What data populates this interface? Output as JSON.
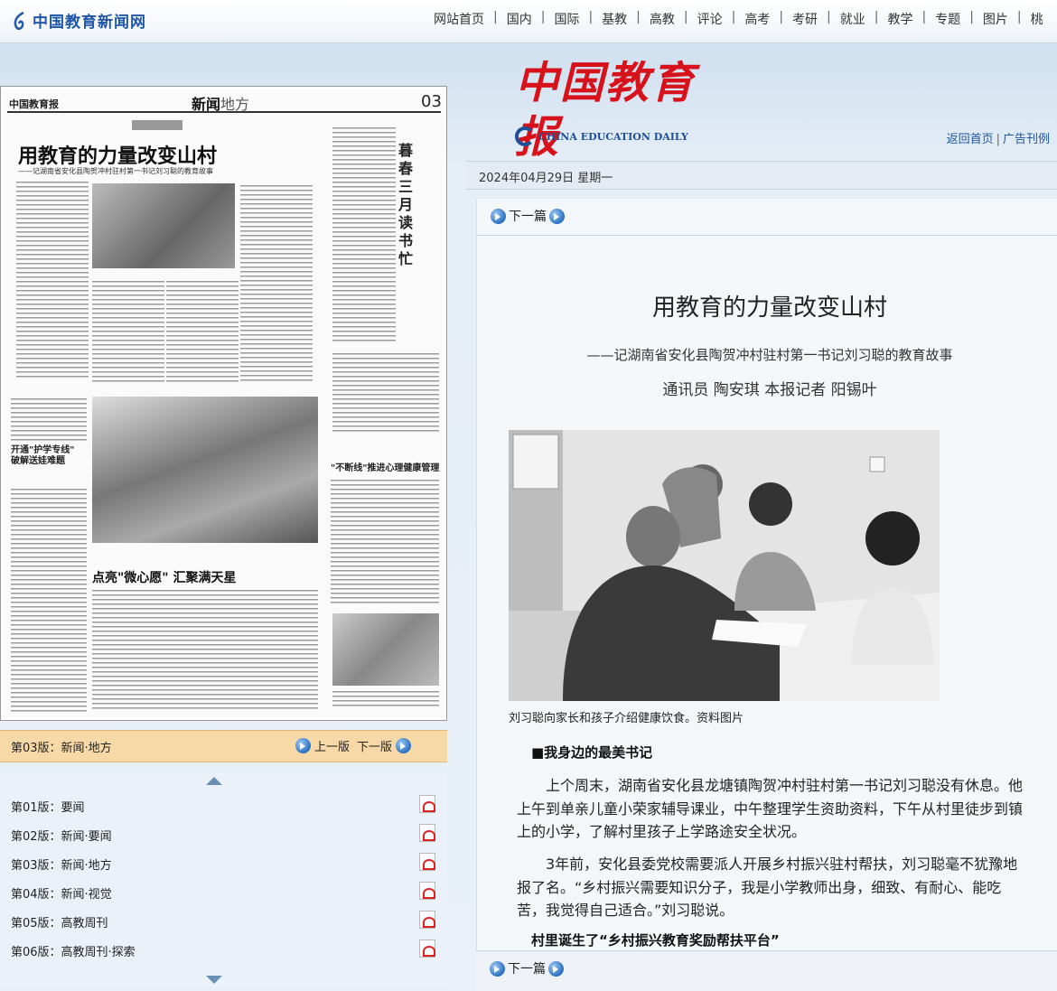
{
  "site": {
    "logo_text": "中国教育新闻网"
  },
  "nav": [
    "网站首页",
    "国内",
    "国际",
    "基教",
    "高教",
    "评论",
    "高考",
    "考研",
    "就业",
    "教学",
    "专题",
    "图片",
    "桃"
  ],
  "masthead": {
    "title_cn": "中国教育报",
    "title_en": "CHINA EDUCATION DAILY"
  },
  "links": {
    "home": "返回首页",
    "ads": "广告刊例"
  },
  "date": "2024年04月29日 星期一",
  "paper_page": {
    "logo": "中国教育报",
    "section": "新闻",
    "section_sub": "地方",
    "page_number": "03",
    "headline": "用教育的力量改变山村",
    "subhead": "——记湖南省安化县陶贺冲村驻村第一书记刘习聪的教育故事",
    "side_title": "暮春三月读书忙",
    "headline2": "开通\"护学专线\" 破解送娃难题",
    "headline3": "\"不断线\"推进心理健康管理",
    "headline4": "点亮\"微心愿\" 汇聚满天星"
  },
  "version_bar": {
    "current": "第03版：",
    "current_name": "新闻·地方",
    "prev": "上一版",
    "next": "下一版"
  },
  "pages": [
    {
      "label": "第01版：",
      "name": "要闻"
    },
    {
      "label": "第02版：",
      "name": "新闻·要闻"
    },
    {
      "label": "第03版：",
      "name": "新闻·地方"
    },
    {
      "label": "第04版：",
      "name": "新闻·视觉"
    },
    {
      "label": "第05版：",
      "name": "高教周刊"
    },
    {
      "label": "第06版：",
      "name": "高教周刊·探索"
    }
  ],
  "article": {
    "next_label": "下一篇",
    "title": "用教育的力量改变山村",
    "subtitle": "——记湖南省安化县陶贺冲村驻村第一书记刘习聪的教育故事",
    "byline": "通讯员 陶安琪 本报记者 阳锡叶",
    "caption": "刘习聪向家长和孩子介绍健康饮食。资料图片",
    "section1": "■我身边的最美书记",
    "para1": "上个周末，湖南省安化县龙塘镇陶贺冲村驻村第一书记刘习聪没有休息。他上午到单亲儿童小荣家辅导课业，中午整理学生资助资料，下午从村里徒步到镇上的小学，了解村里孩子上学路途安全状况。",
    "para2": "3年前，安化县委党校需要派人开展乡村振兴驻村帮扶，刘习聪毫不犹豫地报了名。“乡村振兴需要知识分子，我是小学教师出身，细致、有耐心、能吃苦，我觉得自己适合。”刘习聪说。",
    "section2": "村里诞生了“乡村振兴教育奖励帮扶平台”",
    "bottom_next_label": "下一篇"
  }
}
